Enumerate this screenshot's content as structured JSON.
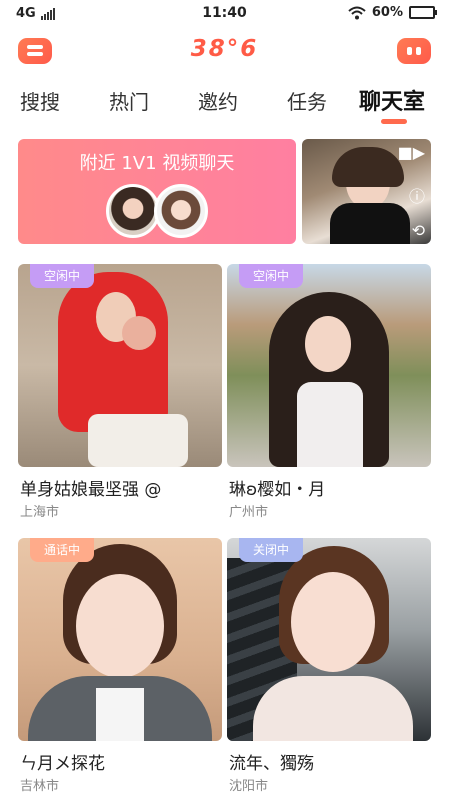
{
  "status_bar": {
    "network": "4G",
    "time": "11:40",
    "battery": "60%",
    "battery_level": 0.6
  },
  "header": {
    "logo": "38°6",
    "menu_icon": "menu-icon",
    "chat_icon": "chat-bubble-icon"
  },
  "tabs": [
    {
      "label": "搜搜",
      "active": false
    },
    {
      "label": "热门",
      "active": false
    },
    {
      "label": "邀约",
      "active": false
    },
    {
      "label": "任务",
      "active": false
    },
    {
      "label": "聊天室",
      "active": true
    }
  ],
  "video_banner": {
    "title": "附近 1V1 视频聊天"
  },
  "colors": {
    "accent": "#ff5b46",
    "banner_gradient_start": "#ff8a8a",
    "banner_gradient_end": "#ff7fa1",
    "badge_idle": "#c59cf5",
    "badge_calling": "#ffab8a",
    "badge_closed": "#a8b6f0"
  },
  "cards": [
    {
      "status": "空闲中",
      "name": "单身姑娘最坚强 @",
      "city": "上海市"
    },
    {
      "status": "空闲中",
      "name": "琳ʚ樱如・月",
      "city": "广州市"
    },
    {
      "status": "通话中",
      "name": "ㄣ月メ探花",
      "city": "吉林市"
    },
    {
      "status": "关闭中",
      "name": "流年、獨殇",
      "city": "沈阳市"
    }
  ]
}
